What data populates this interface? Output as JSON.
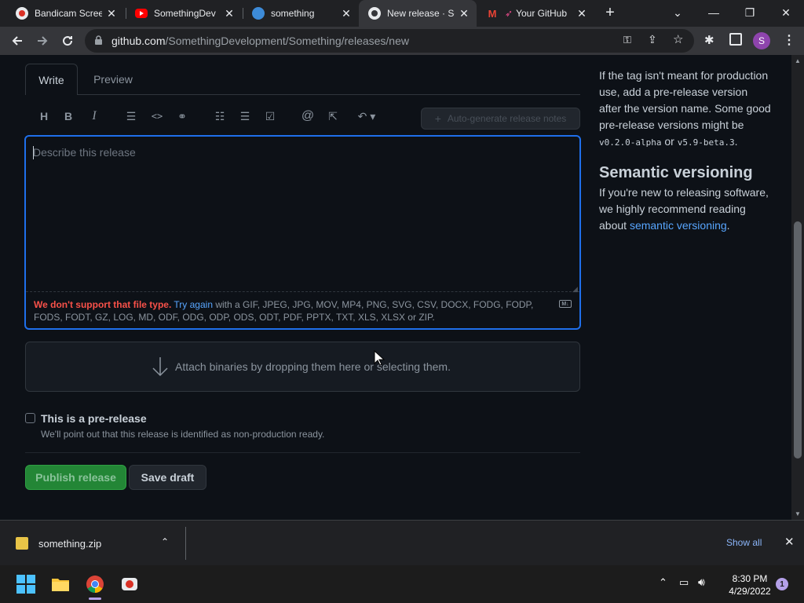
{
  "browser": {
    "tabs": [
      {
        "title": "Bandicam Scree",
        "icon": "bandicam-icon"
      },
      {
        "title": "SomethingDev",
        "icon": "youtube-icon"
      },
      {
        "title": "something",
        "icon": "app-icon"
      },
      {
        "title": "New release · Sc",
        "icon": "github-icon"
      },
      {
        "title": "Your GitHub",
        "icon": "gmail-icon"
      }
    ],
    "url_host": "github.com",
    "url_path": "/SomethingDevelopment/Something/releases/new",
    "profile_initial": "S"
  },
  "editor": {
    "write_tab": "Write",
    "preview_tab": "Preview",
    "autogen_label": "Auto-generate release notes",
    "placeholder": "Describe this release",
    "error_bold": "We don't support that file type.",
    "error_link": "Try again",
    "error_rest": "with a GIF, JPEG, JPG, MOV, MP4, PNG, SVG, CSV, DOCX, FODG, FODP, FODS, FODT, GZ, LOG, MD, ODF, ODG, ODP, ODS, ODT, PDF, PPTX, TXT, XLS, XLSX or ZIP."
  },
  "attach": {
    "text": "Attach binaries by dropping them here or selecting them."
  },
  "prerelease": {
    "label": "This is a pre-release",
    "note": "We'll point out that this release is identified as non-production ready."
  },
  "buttons": {
    "publish": "Publish release",
    "draft": "Save draft"
  },
  "sidebar": {
    "p1_a": "If the tag isn't meant for production use, add a pre-release version after the version name. Some good pre-release versions might be",
    "code1": "v0.2.0-alpha",
    "p1_or": "or",
    "code2": "v5.9-beta.3",
    "p1_end": ".",
    "heading": "Semantic versioning",
    "p2_a": "If you're new to releasing software, we highly recommend reading about",
    "p2_link": "semantic versioning",
    "p2_end": "."
  },
  "downloads": {
    "file": "something.zip",
    "show_all": "Show all"
  },
  "taskbar": {
    "time": "8:30 PM",
    "date": "4/29/2022",
    "notifications": "1"
  }
}
